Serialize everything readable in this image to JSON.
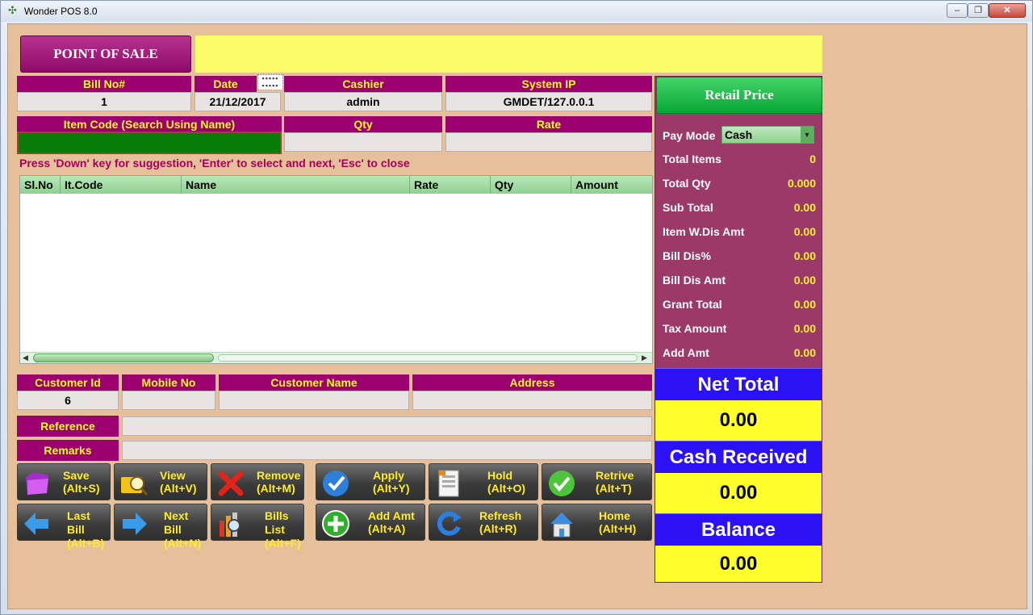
{
  "window": {
    "title": "Wonder POS 8.0",
    "min": "–",
    "max": "❐",
    "close": "✕"
  },
  "header": {
    "pos_title": "POINT OF SALE"
  },
  "bill": {
    "bill_no_label": "Bill No#",
    "bill_no": "1",
    "date_label": "Date",
    "date": "21/12/2017",
    "cashier_label": "Cashier",
    "cashier": "admin",
    "system_ip_label": "System IP",
    "system_ip": "GMDET/127.0.0.1"
  },
  "entry": {
    "item_code_label": "Item Code (Search Using Name)",
    "item_code": "",
    "qty_label": "Qty",
    "qty": "",
    "rate_label": "Rate",
    "rate": "",
    "hint": "Press 'Down' key for suggestion,  'Enter' to select and next,   'Esc' to close"
  },
  "grid": {
    "columns": [
      "Sl.No",
      "It.Code",
      "Name",
      "Rate",
      "Qty",
      "Amount"
    ],
    "rows": []
  },
  "customer": {
    "customer_id_label": "Customer Id",
    "customer_id": "6",
    "mobile_label": "Mobile No",
    "mobile": "",
    "name_label": "Customer Name",
    "name": "",
    "address_label": "Address",
    "address": "",
    "reference_label": "Reference",
    "reference": "",
    "remarks_label": "Remarks",
    "remarks": ""
  },
  "buttons": {
    "save": [
      "Save",
      "(Alt+S)"
    ],
    "view": [
      "View",
      "(Alt+V)"
    ],
    "remove": [
      "Remove",
      "(Alt+M)"
    ],
    "apply": [
      "Apply",
      "(Alt+Y)"
    ],
    "hold": [
      "Hold",
      "(Alt+O)"
    ],
    "retrive": [
      "Retrive",
      "(Alt+T)"
    ],
    "last_bill": [
      "Last",
      "Bill",
      "(Alt+B)"
    ],
    "next_bill": [
      "Next",
      "Bill",
      "(Alt+N)"
    ],
    "bills_list": [
      "Bills",
      "List",
      "(Alt+F)"
    ],
    "add_amt": [
      "Add Amt",
      "(Alt+A)"
    ],
    "refresh": [
      "Refresh",
      "(Alt+R)"
    ],
    "home": [
      "Home",
      "(Alt+H)"
    ]
  },
  "summary": {
    "retail_price": "Retail Price",
    "pay_mode_label": "Pay Mode",
    "pay_mode": "Cash",
    "rows": [
      {
        "label": "Total Items",
        "value": "0"
      },
      {
        "label": "Total Qty",
        "value": "0.000"
      },
      {
        "label": "Sub Total",
        "value": "0.00"
      },
      {
        "label": "Item W.Dis Amt",
        "value": "0.00"
      },
      {
        "label": "Bill Dis%",
        "value": "0.00"
      },
      {
        "label": "Bill Dis Amt",
        "value": "0.00"
      },
      {
        "label": "Grant Total",
        "value": "0.00"
      },
      {
        "label": "Tax Amount",
        "value": "0.00"
      },
      {
        "label": "Add Amt",
        "value": "0.00"
      }
    ],
    "net_total_label": "Net Total",
    "net_total": "0.00",
    "cash_received_label": "Cash Received",
    "cash_received": "0.00",
    "balance_label": "Balance",
    "balance": "0.00"
  },
  "colors": {
    "label_bg": "#9b006e",
    "label_text": "#fffa2e",
    "panel_bg": "#9b3a68",
    "accent_blue": "#2a12f5",
    "accent_yellow": "#fffe2c",
    "client_bg": "#e5c09b"
  }
}
